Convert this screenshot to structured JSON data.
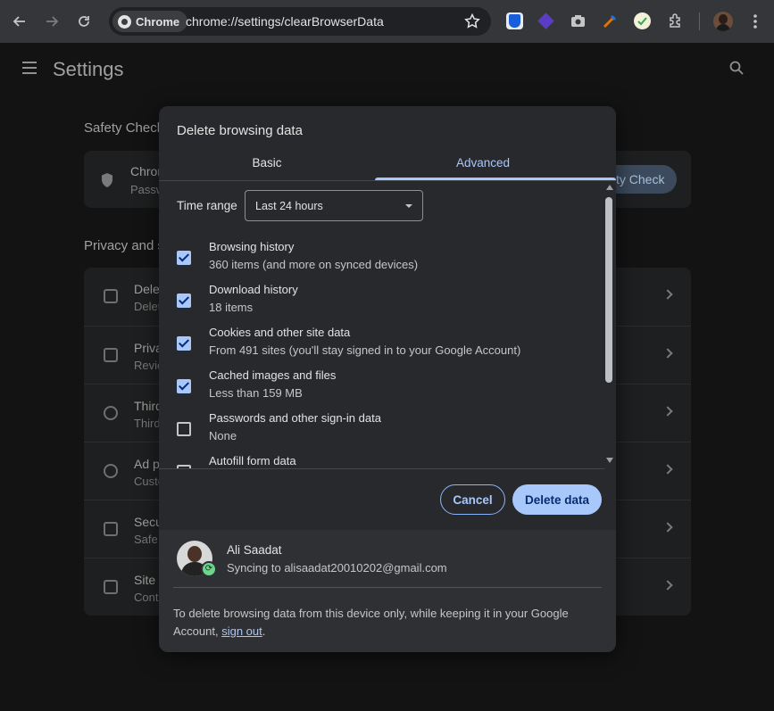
{
  "browser": {
    "chip_label": "Chrome",
    "url": "chrome://settings/clearBrowserData",
    "icons": [
      "back-icon",
      "forward-icon",
      "reload-icon",
      "star-icon",
      "extension-icon",
      "kebab-menu-icon"
    ]
  },
  "settings": {
    "title": "Settings",
    "sections": {
      "safety_check": "Safety Check",
      "privacy": "Privacy and s"
    },
    "safety_card": {
      "title": "Chrom",
      "subtitle": "Passw",
      "button": "ty Check"
    },
    "rows": [
      {
        "t1": "Delet",
        "t2": "Delet"
      },
      {
        "t1": "Priva",
        "t2": "Revie"
      },
      {
        "t1": "Third",
        "t2": "Third"
      },
      {
        "t1": "Ad p",
        "t2": "Custo"
      },
      {
        "t1": "Secu",
        "t2": "Safe"
      },
      {
        "t1": "Site s",
        "t2": "Cont"
      }
    ]
  },
  "dialog": {
    "title": "Delete browsing data",
    "tabs": {
      "basic": "Basic",
      "advanced": "Advanced"
    },
    "time_range_label": "Time range",
    "time_range_value": "Last 24 hours",
    "items": [
      {
        "title": "Browsing history",
        "desc": "360 items (and more on synced devices)",
        "checked": true
      },
      {
        "title": "Download history",
        "desc": "18 items",
        "checked": true
      },
      {
        "title": "Cookies and other site data",
        "desc": "From 491 sites (you'll stay signed in to your Google Account)",
        "checked": true
      },
      {
        "title": "Cached images and files",
        "desc": "Less than 159 MB",
        "checked": true
      },
      {
        "title": "Passwords and other sign-in data",
        "desc": "None",
        "checked": false
      },
      {
        "title": "Autofill form data",
        "desc": "",
        "checked": false
      }
    ],
    "cancel_label": "Cancel",
    "delete_label": "Delete data",
    "account": {
      "name": "Ali Saadat",
      "email": "Syncing to alisaadat20010202@gmail.com"
    },
    "note_prefix": "To delete browsing data from this device only, while keeping it in your Google Account, ",
    "note_link": "sign out",
    "note_suffix": "."
  },
  "colors": {
    "accent": "#a8c7fa",
    "dialog_bg": "#28292c",
    "toolbar_bg": "#35363a"
  }
}
